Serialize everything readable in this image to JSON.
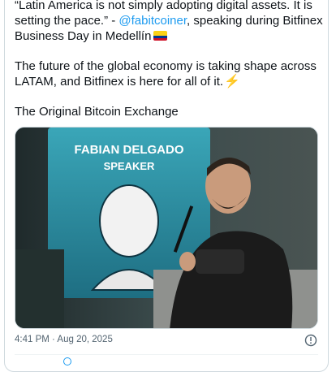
{
  "tweet": {
    "line1_part1": "“Latin America is not simply adopting digital assets. It is setting the pace.” - ",
    "mention": "@fabitcoiner",
    "line1_part2": ", speaking during Bitfinex Business Day in Medellín",
    "para2": "The future of the global economy is taking shape across LATAM, and Bitfinex is here for all of it.",
    "para3": "The Original Bitcoin Exchange"
  },
  "media": {
    "screen_name": "FABIAN DELGADO",
    "screen_role": "SPEAKER"
  },
  "meta": {
    "timestamp": "4:41 PM · Aug 20, 2025"
  },
  "icons": {
    "flag": "colombia-flag-icon",
    "bolt": "lightning-icon",
    "info": "info-icon"
  },
  "colors": {
    "accent": "#1d9bf0",
    "text": "#0f1419",
    "muted": "#536471"
  }
}
